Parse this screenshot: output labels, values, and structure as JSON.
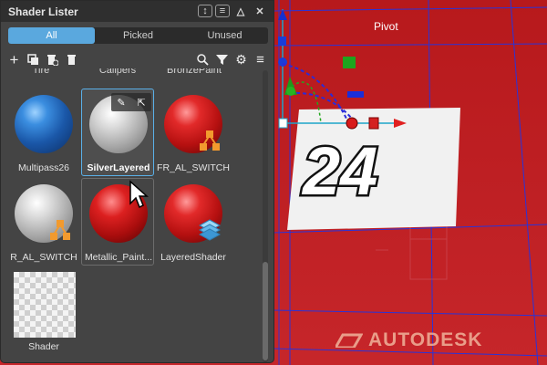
{
  "panel": {
    "title": "Shader Lister",
    "window_buttons": [
      "reorder-icon",
      "menu-icon",
      "collapse-icon",
      "close-icon"
    ]
  },
  "tabs": [
    {
      "label": "All",
      "active": true
    },
    {
      "label": "Picked",
      "active": false
    },
    {
      "label": "Unused",
      "active": false
    }
  ],
  "toolbar": {
    "left_icons": [
      "add-icon",
      "duplicate-icon",
      "delete-unused-icon",
      "delete-icon"
    ],
    "right_icons": [
      "search-icon",
      "filter-icon",
      "settings-icon",
      "list-menu-icon"
    ]
  },
  "grid": {
    "top_row_labels": [
      "Tire",
      "Calipers",
      "BronzePaint"
    ],
    "items": [
      {
        "label": "Multipass26",
        "material": "blue",
        "badge": false,
        "selected": false
      },
      {
        "label": "SilverLayered",
        "material": "silver",
        "badge": false,
        "selected": true
      },
      {
        "label": "FR_AL_SWITCH",
        "material": "red",
        "badge": "switch-icon",
        "selected": false
      },
      {
        "label": "R_AL_SWITCH",
        "material": "silver",
        "badge": "switch-icon",
        "selected": false
      },
      {
        "label": "Metallic_Paint...",
        "material": "red",
        "badge": false,
        "selected": false
      },
      {
        "label": "LayeredShader",
        "material": "red",
        "badge": "layers-icon",
        "selected": false
      },
      {
        "label": "Shader",
        "material": "checker",
        "badge": false,
        "selected": false
      }
    ]
  },
  "viewport": {
    "pivot_label": "Pivot",
    "decal_number": "24",
    "brand_text": "AUTODESK"
  },
  "colors": {
    "accent": "#5aa8de",
    "viewport_red": "#bd1f22",
    "panel_bg": "#444444"
  }
}
